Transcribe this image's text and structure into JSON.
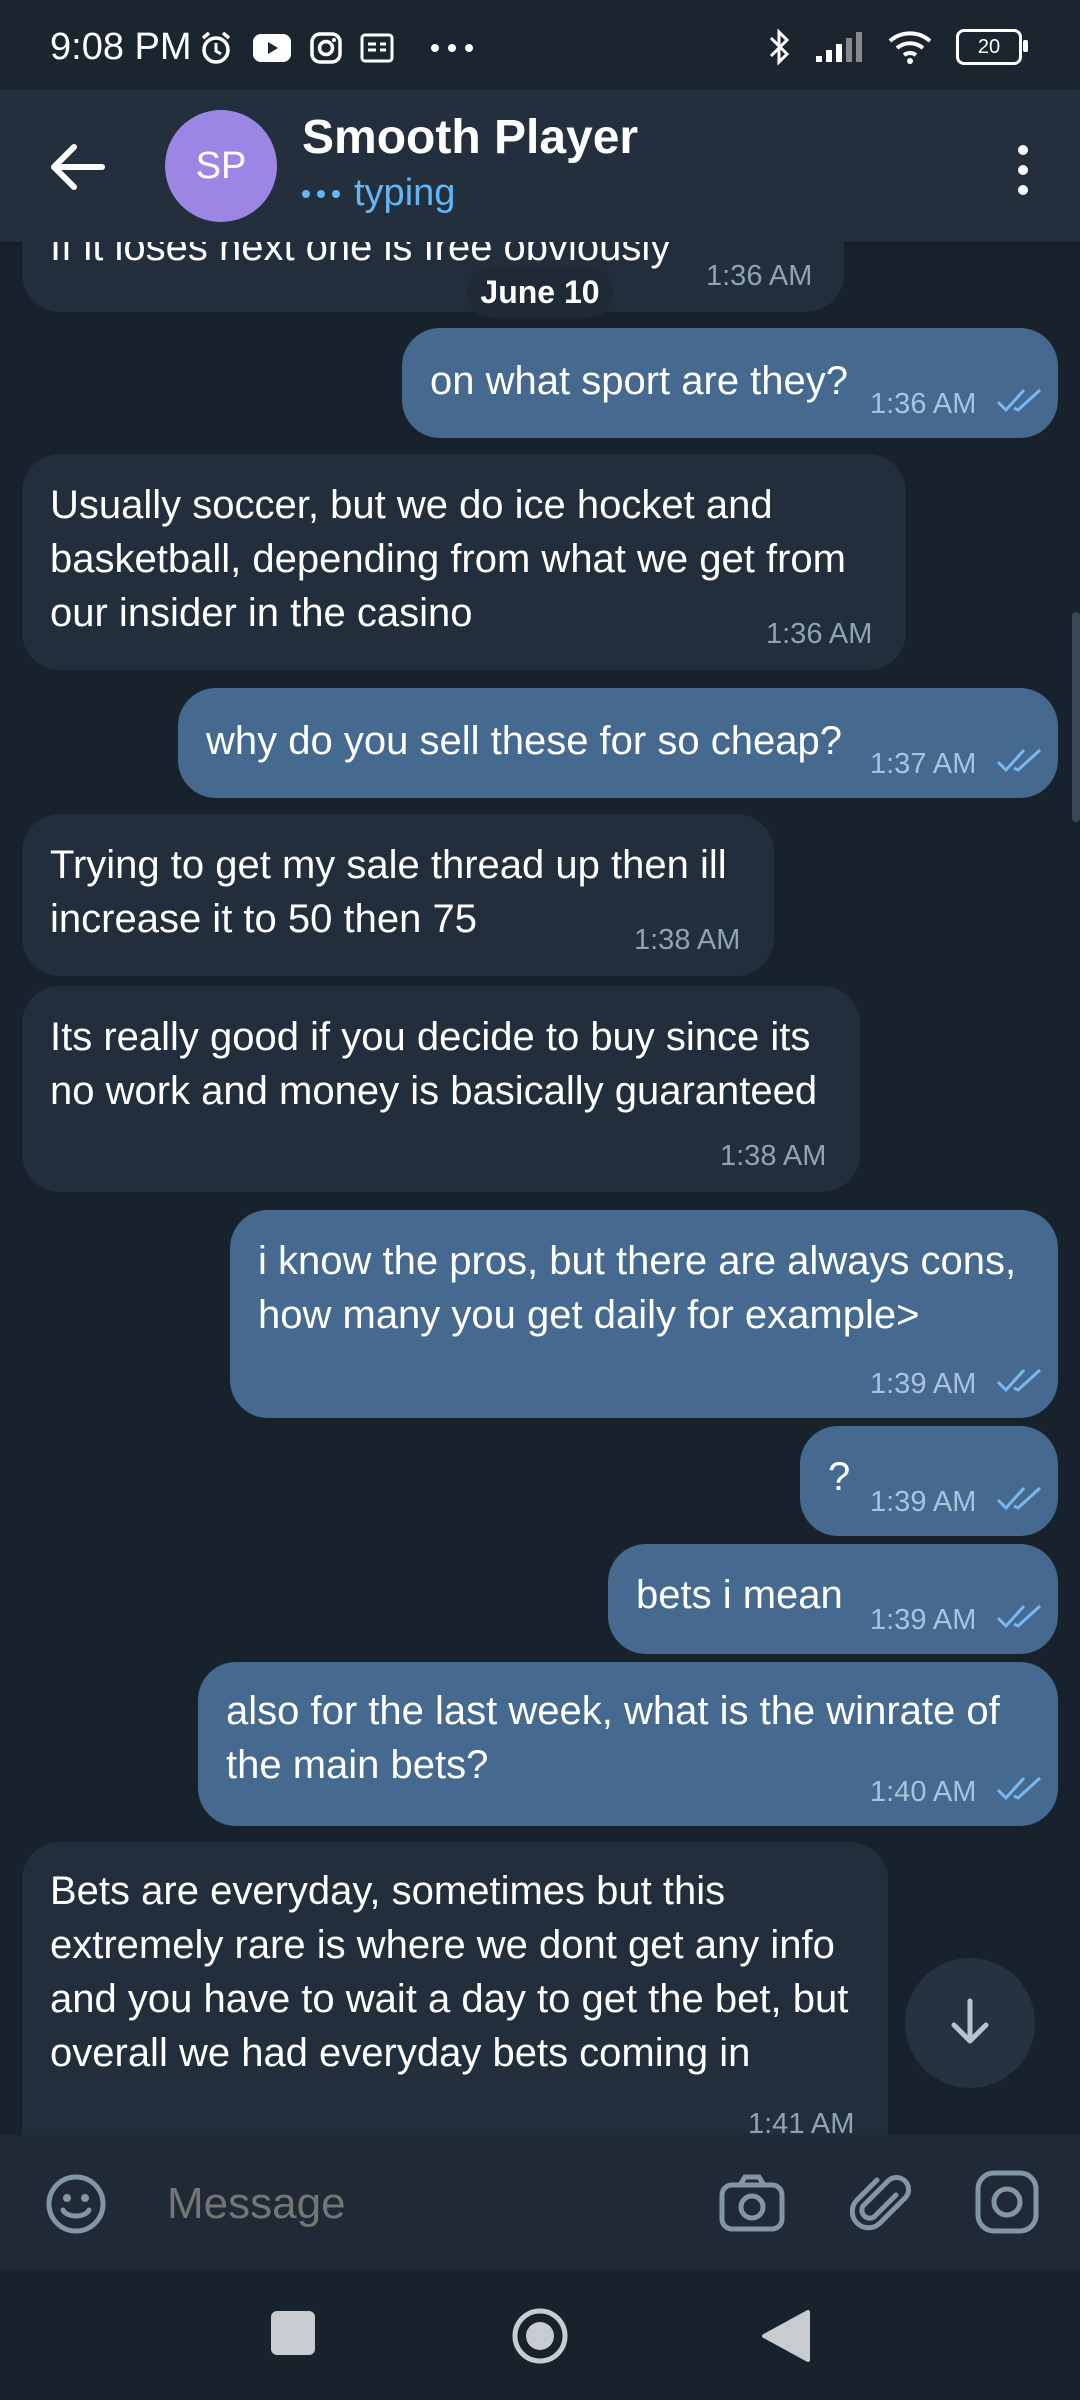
{
  "status_bar": {
    "time": "9:08 PM",
    "battery": "20",
    "icons_left": [
      "alarm-icon",
      "youtube-icon",
      "instagram-icon",
      "gallery-icon",
      "more-dots-icon"
    ],
    "icons_right": [
      "bluetooth-icon",
      "signal-icon",
      "wifi-icon",
      "battery-icon"
    ]
  },
  "header": {
    "avatar_initials": "SP",
    "avatar_color": "#9b86e4",
    "name": "Smooth Player",
    "status": "typing"
  },
  "date_separator": "June 10",
  "messages": [
    {
      "direction": "in",
      "text": "If it loses next one is free obviously",
      "time": "1:36 AM"
    },
    {
      "direction": "out",
      "text": "on what sport are they?",
      "time": "1:36 AM",
      "read": true
    },
    {
      "direction": "in",
      "text": "Usually soccer, but we do ice hocket and\nbasketball, depending from what we get from\nour insider in the casino",
      "time": "1:36 AM"
    },
    {
      "direction": "out",
      "text": "why do you sell these for so cheap?",
      "time": "1:37 AM",
      "read": true
    },
    {
      "direction": "in",
      "text": "Trying to get my sale thread up then ill\nincrease it to 50 then 75",
      "time": "1:38 AM"
    },
    {
      "direction": "in",
      "text": "Its really good if you decide to buy since its\nno work and money is basically guaranteed",
      "time": "1:38 AM"
    },
    {
      "direction": "out",
      "text": "i know the pros, but there are always cons,\nhow many you get daily for example>",
      "time": "1:39 AM",
      "read": true
    },
    {
      "direction": "out",
      "text": "?",
      "time": "1:39 AM",
      "read": true
    },
    {
      "direction": "out",
      "text": "bets i mean",
      "time": "1:39 AM",
      "read": true
    },
    {
      "direction": "out",
      "text": "also for the last week, what is the winrate of\nthe main bets?",
      "time": "1:40 AM",
      "read": true
    },
    {
      "direction": "in",
      "text": "Bets are everyday, sometimes but this\nextremely rare is where we dont get any info\nand you have to wait a day to get the bet, but\noverall we had everyday bets coming in",
      "time": "1:41 AM"
    }
  ],
  "composer": {
    "placeholder": "Message"
  },
  "colors": {
    "background": "#18222d",
    "header": "#242f3d",
    "incoming_bubble": "#222e3b",
    "outgoing_bubble": "#45698f",
    "accent": "#64b5f6"
  }
}
